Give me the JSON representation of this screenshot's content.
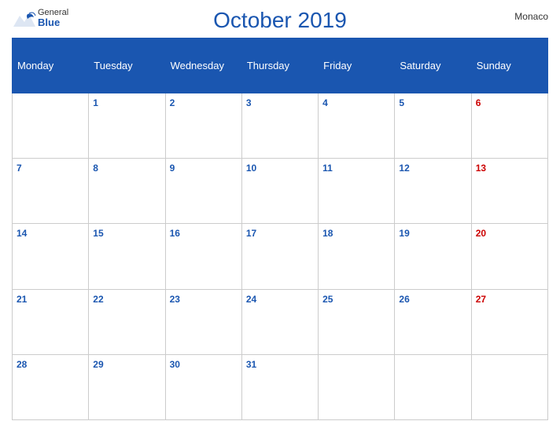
{
  "header": {
    "title": "October 2019",
    "country": "Monaco",
    "logo_general": "General",
    "logo_blue": "Blue"
  },
  "weekdays": [
    {
      "label": "Monday",
      "key": "mon"
    },
    {
      "label": "Tuesday",
      "key": "tue"
    },
    {
      "label": "Wednesday",
      "key": "wed"
    },
    {
      "label": "Thursday",
      "key": "thu"
    },
    {
      "label": "Friday",
      "key": "fri"
    },
    {
      "label": "Saturday",
      "key": "sat"
    },
    {
      "label": "Sunday",
      "key": "sun"
    }
  ],
  "weeks": [
    [
      null,
      "1",
      "2",
      "3",
      "4",
      "5",
      "6"
    ],
    [
      "7",
      "8",
      "9",
      "10",
      "11",
      "12",
      "13"
    ],
    [
      "14",
      "15",
      "16",
      "17",
      "18",
      "19",
      "20"
    ],
    [
      "21",
      "22",
      "23",
      "24",
      "25",
      "26",
      "27"
    ],
    [
      "28",
      "29",
      "30",
      "31",
      null,
      null,
      null
    ]
  ]
}
